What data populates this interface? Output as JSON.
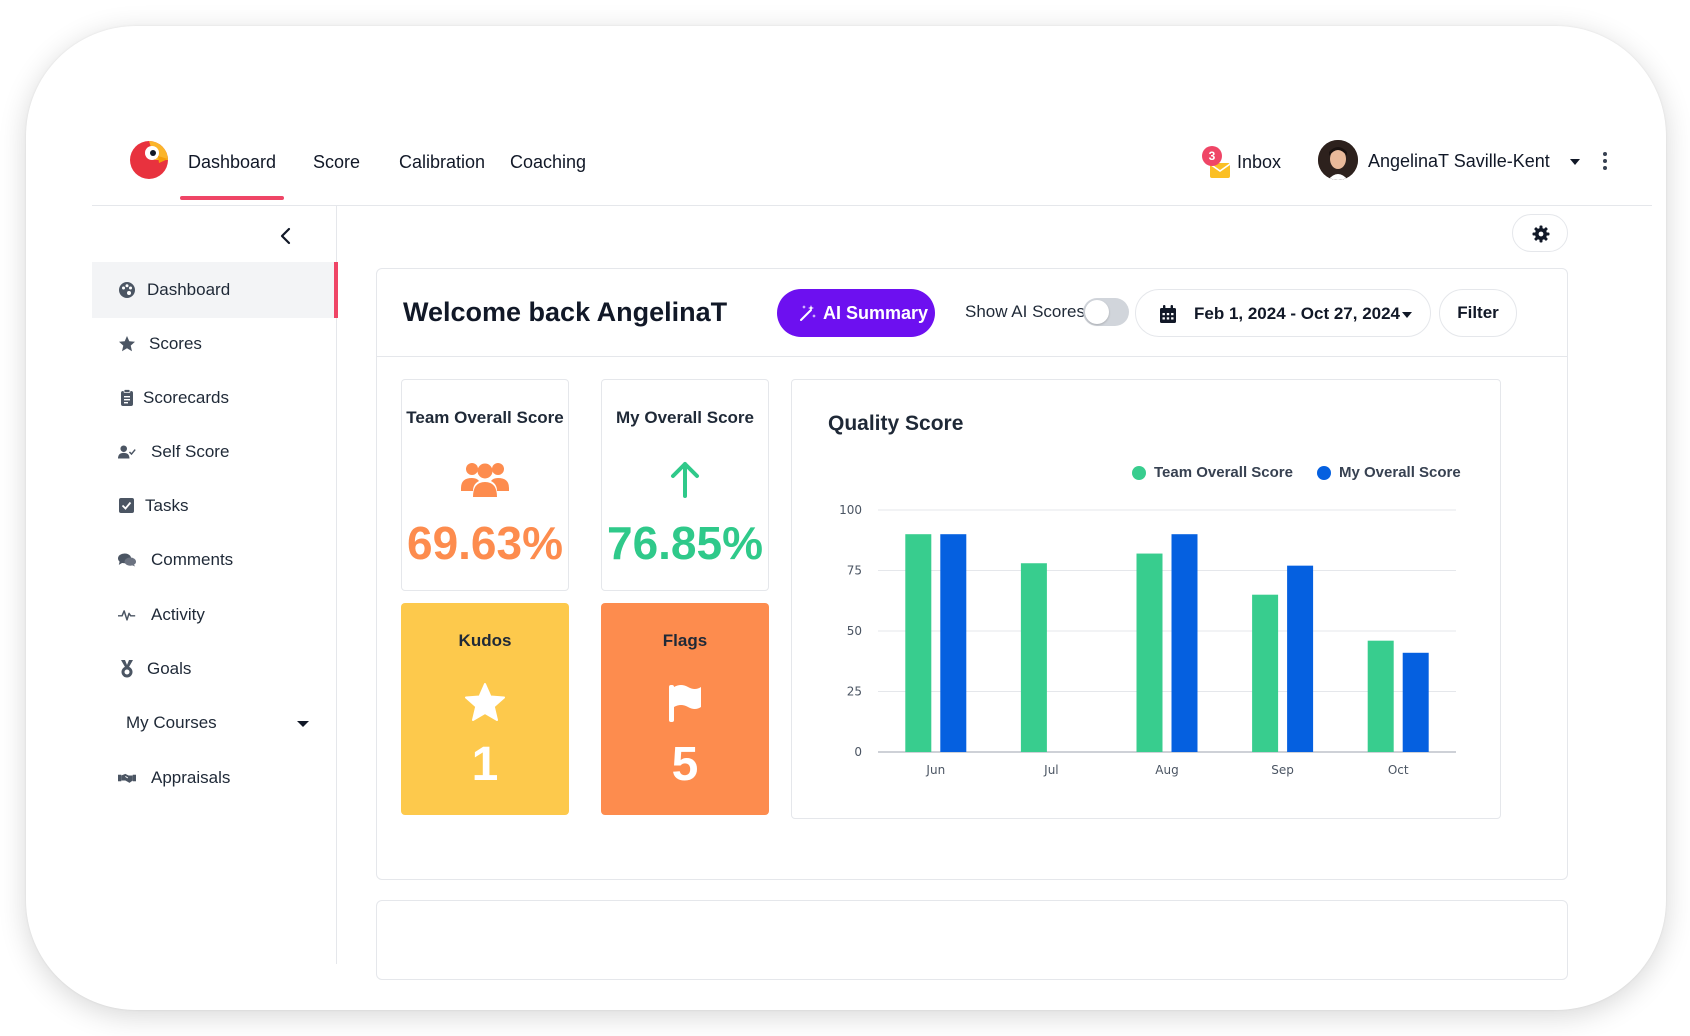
{
  "nav": {
    "tabs": [
      {
        "label": "Dashboard",
        "active": true
      },
      {
        "label": "Score"
      },
      {
        "label": "Calibration"
      },
      {
        "label": "Coaching"
      }
    ],
    "inbox": {
      "label": "Inbox",
      "count": "3"
    },
    "user": {
      "name": "AngelinaT Saville-Kent"
    }
  },
  "sidebar": {
    "items": [
      {
        "label": "Dashboard",
        "icon": "palette-icon",
        "active": true
      },
      {
        "label": "Scores",
        "icon": "star-icon"
      },
      {
        "label": "Scorecards",
        "icon": "clipboard-icon"
      },
      {
        "label": "Self Score",
        "icon": "user-check-icon"
      },
      {
        "label": "Tasks",
        "icon": "checkbox-icon"
      },
      {
        "label": "Comments",
        "icon": "comments-icon"
      },
      {
        "label": "Activity",
        "icon": "pulse-icon"
      },
      {
        "label": "Goals",
        "icon": "medal-icon"
      },
      {
        "label": "My Courses",
        "icon": "caret-down-icon"
      },
      {
        "label": "Appraisals",
        "icon": "handshake-icon"
      }
    ]
  },
  "main": {
    "welcome": "Welcome back AngelinaT",
    "ai_summary_label": "AI Summary",
    "show_ai_label": "Show AI Scores",
    "show_ai_enabled": false,
    "date_range": "Feb 1, 2024 - Oct 27, 2024",
    "filter_label": "Filter",
    "stats": {
      "team": {
        "title": "Team Overall Score",
        "value": "69.63%",
        "icon": "users-icon",
        "color": "#fd8c4e"
      },
      "mine": {
        "title": "My Overall Score",
        "value": "76.85%",
        "icon": "arrow-up-icon",
        "color": "#2fc98a"
      },
      "kudos": {
        "title": "Kudos",
        "value": "1",
        "icon": "star-icon",
        "color": "#fdc94c"
      },
      "flags": {
        "title": "Flags",
        "value": "5",
        "icon": "flag-icon",
        "color": "#fd8c4e"
      }
    }
  },
  "colors": {
    "accent": "#ef4566",
    "ai_purple": "#6d10f0",
    "team_series": "#38cd8e",
    "my_series": "#0560e0"
  },
  "chart_data": {
    "type": "bar",
    "title": "Quality Score",
    "categories": [
      "Jun",
      "Jul",
      "Aug",
      "Sep",
      "Oct"
    ],
    "series": [
      {
        "name": "Team Overall Score",
        "values": [
          90,
          78,
          82,
          65,
          46
        ]
      },
      {
        "name": "My Overall Score",
        "values": [
          90,
          null,
          90,
          77,
          41
        ]
      }
    ],
    "ylim": [
      0,
      100
    ],
    "yticks": [
      0,
      25,
      50,
      75,
      100
    ],
    "grid": true,
    "legend": "top-right"
  }
}
